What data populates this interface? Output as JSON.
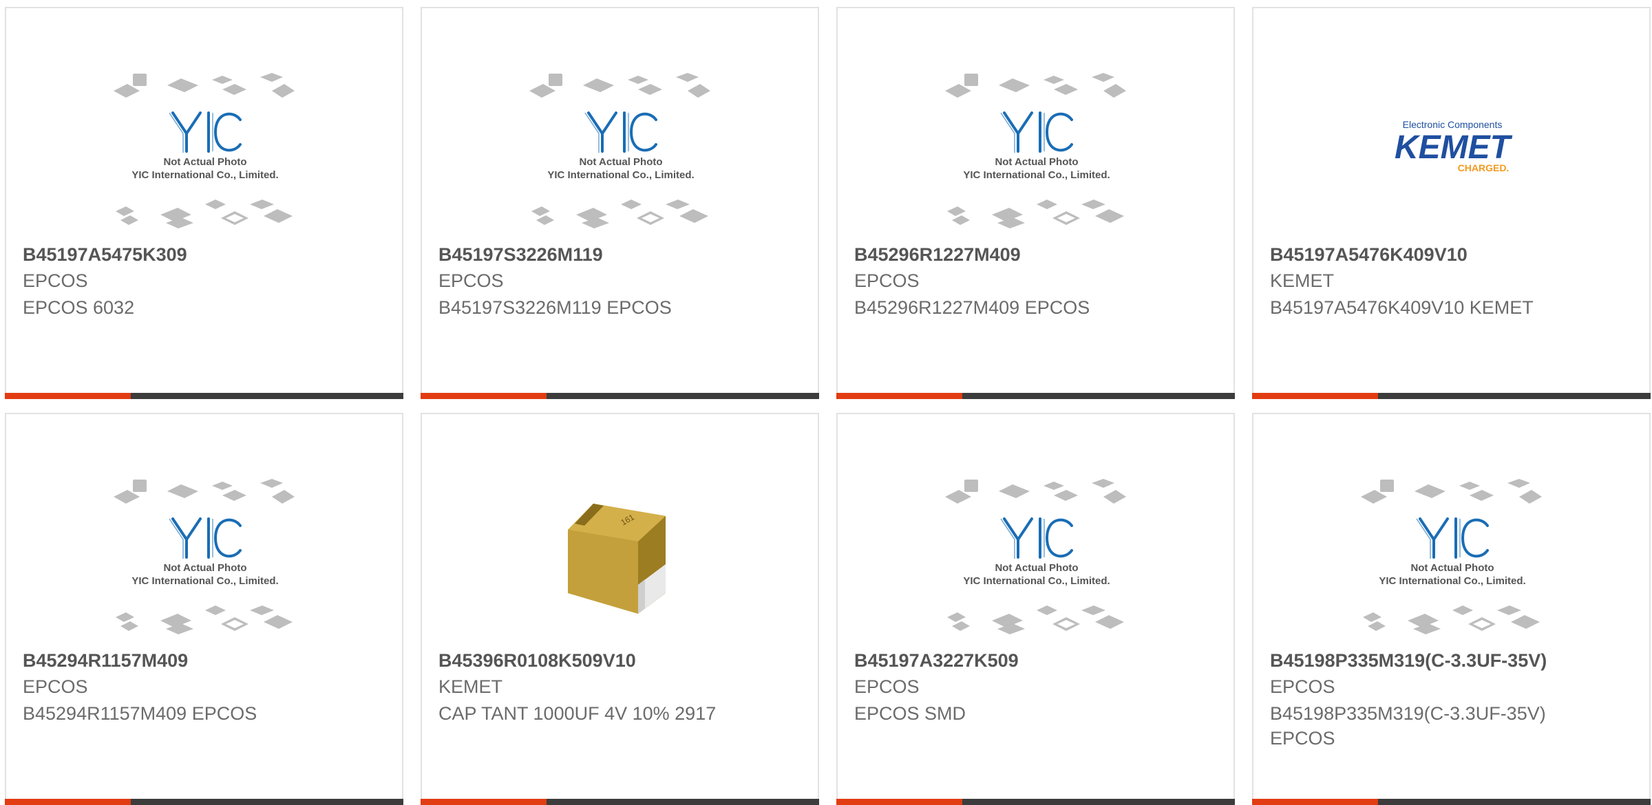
{
  "products": [
    {
      "part_number": "B45197A5475K309",
      "manufacturer": "EPCOS",
      "description": "EPCOS 6032",
      "image": "yic-placeholder"
    },
    {
      "part_number": "B45197S3226M119",
      "manufacturer": "EPCOS",
      "description": "B45197S3226M119 EPCOS",
      "image": "yic-placeholder"
    },
    {
      "part_number": "B45296R1227M409",
      "manufacturer": "EPCOS",
      "description": "B45296R1227M409 EPCOS",
      "image": "yic-placeholder"
    },
    {
      "part_number": "B45197A5476K409V10",
      "manufacturer": "KEMET",
      "description": "B45197A5476K409V10 KEMET",
      "image": "kemet-logo"
    },
    {
      "part_number": "B45294R1157M409",
      "manufacturer": "EPCOS",
      "description": "B45294R1157M409 EPCOS",
      "image": "yic-placeholder"
    },
    {
      "part_number": "B45396R0108K509V10",
      "manufacturer": "KEMET",
      "description": "CAP TANT 1000UF 4V 10% 2917",
      "image": "tantalum-capacitor-photo"
    },
    {
      "part_number": "B45197A3227K509",
      "manufacturer": "EPCOS",
      "description": "EPCOS SMD",
      "image": "yic-placeholder"
    },
    {
      "part_number": "B45198P335M319(C-3.3UF-35V)",
      "manufacturer": "EPCOS",
      "description": "B45198P335M319(C-3.3UF-35V) EPCOS",
      "image": "yic-placeholder"
    }
  ],
  "placeholder": {
    "line1": "Not Actual Photo",
    "line2": "YIC International Co., Limited.",
    "brand": "YIC"
  },
  "kemet_logo": {
    "tagline": "Electronic Components",
    "name": "KEMET",
    "sub": "CHARGED."
  },
  "colors": {
    "accent": "#e23c12",
    "bar": "#3c3c3c",
    "border": "#e2e2e2",
    "part_text": "#555555",
    "meta_text": "#6b6b6b",
    "yic_blue": "#1a6db5",
    "kemet_blue": "#1f4fa0",
    "kemet_orange": "#f39a1e"
  }
}
